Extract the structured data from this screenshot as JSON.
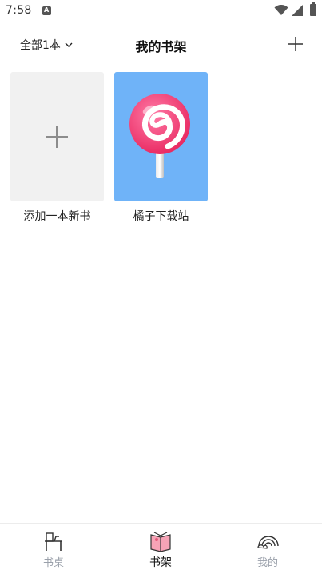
{
  "status_bar": {
    "time": "7:58",
    "notification_icon": "A"
  },
  "header": {
    "filter_label": "全部1本",
    "title": "我的书架",
    "add_icon": "plus-icon"
  },
  "books": [
    {
      "title": "添加一本新书",
      "icon": "plus-icon",
      "cover_color": "#f1f1f1"
    },
    {
      "title": "橘子下载站",
      "icon": "lollipop-icon",
      "cover_color": "#6fb3f8"
    }
  ],
  "bottom_nav": {
    "items": [
      {
        "label": "书桌",
        "icon": "desk-icon",
        "active": false
      },
      {
        "label": "书架",
        "icon": "bookshelf-icon",
        "active": true
      },
      {
        "label": "我的",
        "icon": "profile-rainbow-icon",
        "active": false
      }
    ],
    "active_color": "#111111",
    "inactive_color": "#9aa0aa"
  }
}
